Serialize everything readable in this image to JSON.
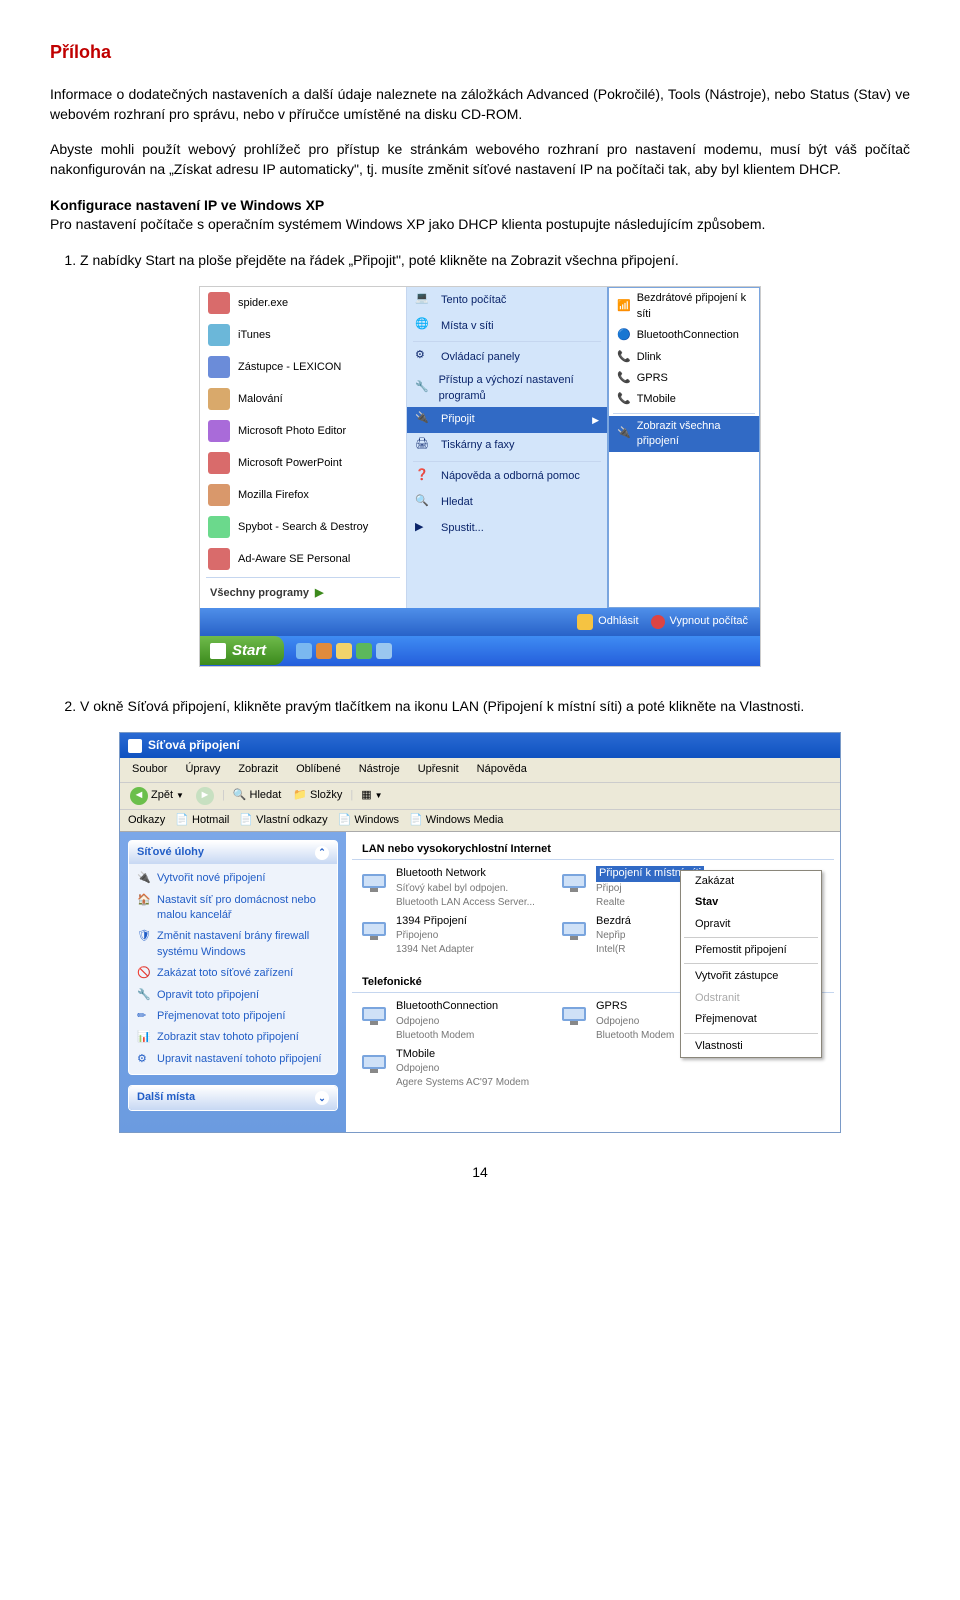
{
  "title": "Příloha",
  "para1": "Informace o dodatečných nastaveních a další údaje naleznete na záložkách Advanced (Pokročilé), Tools (Nástroje), nebo Status (Stav) ve webovém rozhraní pro správu, nebo v příručce umístěné na disku CD-ROM.",
  "para2": "Abyste mohli použít webový prohlížeč pro přístup ke stránkám webového rozhraní pro nastavení modemu, musí být váš počítač nakonfigurován na „Získat adresu IP automaticky\", tj. musíte změnit síťové nastavení IP na počítači tak, aby byl klientem DHCP.",
  "subheading": "Konfigurace nastavení IP ve Windows XP",
  "para3": "Pro nastavení počítače s operačním systémem Windows XP jako DHCP klienta postupujte následujícím způsobem.",
  "step1": "Z nabídky Start na ploše přejděte na řádek „Připojit\", poté klikněte na Zobrazit všechna připojení.",
  "step2": "V okně Síťová připojení, klikněte pravým tlačítkem na ikonu LAN (Připojení k místní síti) a poté klikněte na Vlastnosti.",
  "startmenu": {
    "left": [
      {
        "label": "spider.exe"
      },
      {
        "label": "iTunes"
      },
      {
        "label": "Zástupce - LEXICON"
      },
      {
        "label": "Malování"
      },
      {
        "label": "Microsoft Photo Editor"
      },
      {
        "label": "Microsoft PowerPoint"
      },
      {
        "label": "Mozilla Firefox"
      },
      {
        "label": "Spybot - Search & Destroy"
      },
      {
        "label": "Ad-Aware SE Personal"
      }
    ],
    "all_programs": "Všechny programy",
    "right": [
      {
        "label": "Tento počítač"
      },
      {
        "label": "Místa v síti"
      },
      {
        "label": "Ovládací panely"
      },
      {
        "label": "Přístup a výchozí nastavení programů"
      },
      {
        "label": "Připojit",
        "hl": true,
        "arrow": true
      },
      {
        "label": "Tiskárny a faxy"
      },
      {
        "label": "Nápověda a odborná pomoc"
      },
      {
        "label": "Hledat"
      },
      {
        "label": "Spustit..."
      }
    ],
    "submenu": [
      {
        "label": "Bezdrátové připojení k síti"
      },
      {
        "label": "BluetoothConnection"
      },
      {
        "label": "Dlink"
      },
      {
        "label": "GPRS"
      },
      {
        "label": "TMobile"
      },
      {
        "label": "Zobrazit všechna připojení",
        "hl": true
      }
    ],
    "logoff": "Odhlásit",
    "turnoff": "Vypnout počítač",
    "startbtn": "Start"
  },
  "ncwin": {
    "title": "Síťová připojení",
    "menu": [
      "Soubor",
      "Úpravy",
      "Zobrazit",
      "Oblíbené",
      "Nástroje",
      "Upřesnit",
      "Nápověda"
    ],
    "toolbar": {
      "back": "Zpět",
      "search": "Hledat",
      "folders": "Složky"
    },
    "linkbar": {
      "label": "Odkazy",
      "items": [
        "Hotmail",
        "Vlastní odkazy",
        "Windows",
        "Windows Media"
      ]
    },
    "side_panel1_title": "Síťové úlohy",
    "side_tasks": [
      "Vytvořit nové připojení",
      "Nastavit síť pro domácnost nebo malou kancelář",
      "Změnit nastavení brány firewall systému Windows",
      "Zakázat toto síťové zařízení",
      "Opravit toto připojení",
      "Přejmenovat toto připojení",
      "Zobrazit stav tohoto připojení",
      "Upravit nastavení tohoto připojení"
    ],
    "side_panel2_title": "Další místa",
    "group1": "LAN nebo vysokorychlostní Internet",
    "group2": "Telefonické",
    "items_lan": [
      {
        "name": "Bluetooth Network",
        "desc": "Síťový kabel byl odpojen.",
        "desc2": "Bluetooth LAN Access Server..."
      },
      {
        "name": "Připojení k místní síti",
        "desc": "Připoj",
        "desc2": "Realte",
        "sel": true
      },
      {
        "name": "1394 Připojení",
        "desc": "Připojeno",
        "desc2": "1394 Net Adapter"
      },
      {
        "name": "Bezdrá",
        "desc": "Nepřip",
        "desc2": "Intel(R"
      }
    ],
    "items_tel": [
      {
        "name": "BluetoothConnection",
        "desc": "Odpojeno",
        "desc2": "Bluetooth Modem"
      },
      {
        "name": "GPRS",
        "desc": "Odpojeno",
        "desc2": "Bluetooth Modem"
      },
      {
        "name": "TMobile",
        "desc": "Odpojeno",
        "desc2": "Agere Systems AC'97 Modem"
      }
    ],
    "ctx": [
      "Zakázat",
      "Stav",
      "Opravit",
      "Přemostit připojení",
      "Vytvořit zástupce",
      "Odstranit",
      "Přejmenovat",
      "Vlastnosti"
    ]
  },
  "pagenum": "14"
}
